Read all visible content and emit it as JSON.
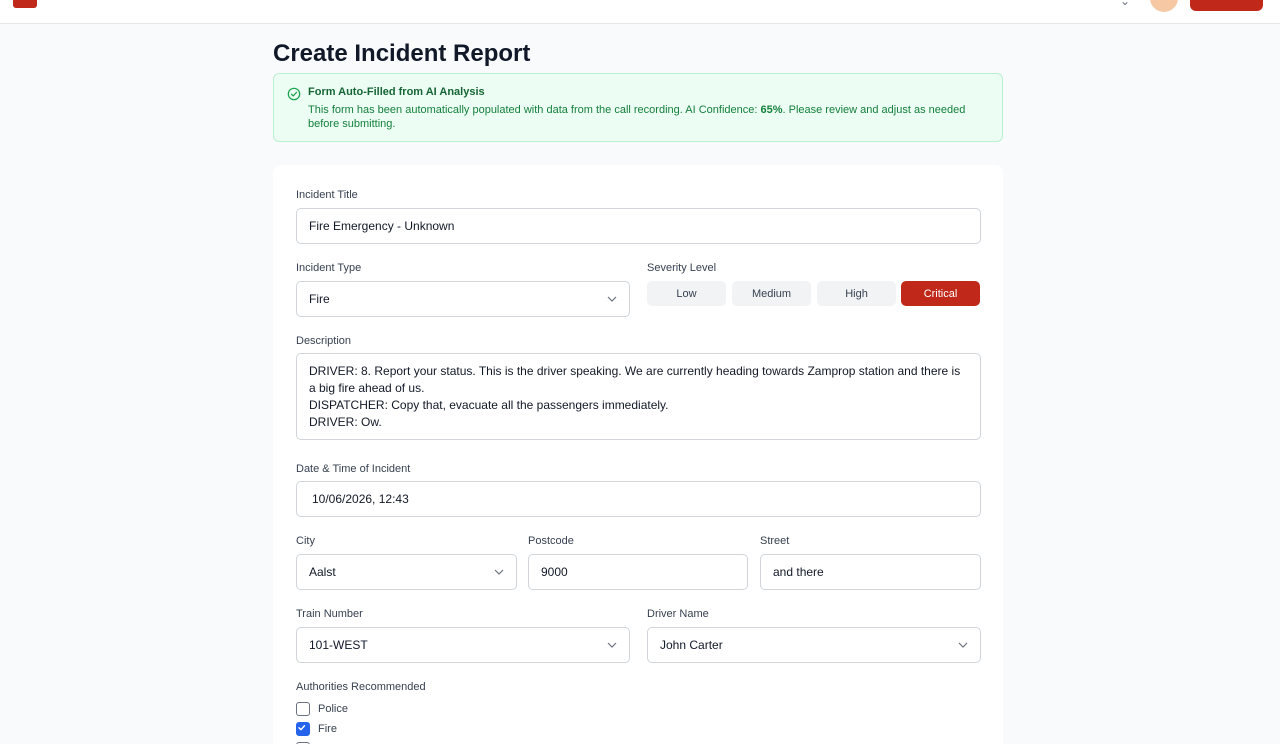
{
  "page": {
    "title": "Create Incident Report"
  },
  "alert": {
    "title": "Form Auto-Filled from AI Analysis",
    "body_prefix": "This form has been automatically populated with data from the call recording. AI Confidence: ",
    "confidence": "65%",
    "body_suffix": ". Please review and adjust as needed before submitting.",
    "icon": "check-circle-icon",
    "color": "#15803d"
  },
  "form": {
    "incident_title": {
      "label": "Incident Title",
      "value": "Fire Emergency - Unknown"
    },
    "incident_type": {
      "label": "Incident Type",
      "value": "Fire"
    },
    "severity": {
      "label": "Severity Level",
      "options": [
        "Low",
        "Medium",
        "High",
        "Critical"
      ],
      "selected": "Critical",
      "active_color": "#c0281a"
    },
    "description": {
      "label": "Description",
      "lines": [
        "DRIVER: 8. Report your status. This is the driver speaking. We are currently heading towards Zamprop station and there is a big fire ahead of us.",
        "DISPATCHER: Copy that, evacuate all the passengers immediately.",
        "DRIVER: Ow."
      ]
    },
    "datetime": {
      "label": "Date & Time of Incident",
      "value": "10/06/2026, 12:43"
    },
    "city": {
      "label": "City",
      "value": "Aalst"
    },
    "postcode": {
      "label": "Postcode",
      "value": "9000"
    },
    "street": {
      "label": "Street",
      "value": "and there"
    },
    "train_number": {
      "label": "Train Number",
      "value": "101-WEST"
    },
    "driver_name": {
      "label": "Driver Name",
      "value": "John Carter"
    },
    "authorities": {
      "label": "Authorities Recommended",
      "items": [
        {
          "label": "Police",
          "checked": false
        },
        {
          "label": "Fire",
          "checked": true
        }
      ]
    }
  }
}
